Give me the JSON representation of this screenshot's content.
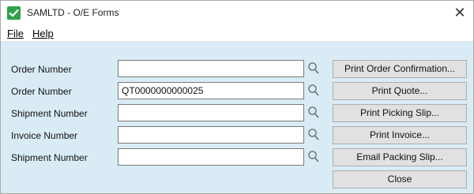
{
  "window": {
    "title": "SAMLTD - O/E Forms"
  },
  "menu": {
    "file": "File",
    "help": "Help"
  },
  "rows": [
    {
      "label": "Order Number",
      "value": "",
      "button": "Print Order Confirmation..."
    },
    {
      "label": "Order Number",
      "value": "QT0000000000025",
      "button": "Print Quote..."
    },
    {
      "label": "Shipment Number",
      "value": "",
      "button": "Print Picking Slip..."
    },
    {
      "label": "Invoice Number",
      "value": "",
      "button": "Print Invoice..."
    },
    {
      "label": "Shipment Number",
      "value": "",
      "button": "Email Packing Slip..."
    }
  ],
  "close_button": "Close",
  "icons": {
    "finder": "magnifier-icon",
    "app": "app-icon"
  },
  "colors": {
    "panel": "#d9ecf5",
    "app_icon": "#2fa24a"
  }
}
